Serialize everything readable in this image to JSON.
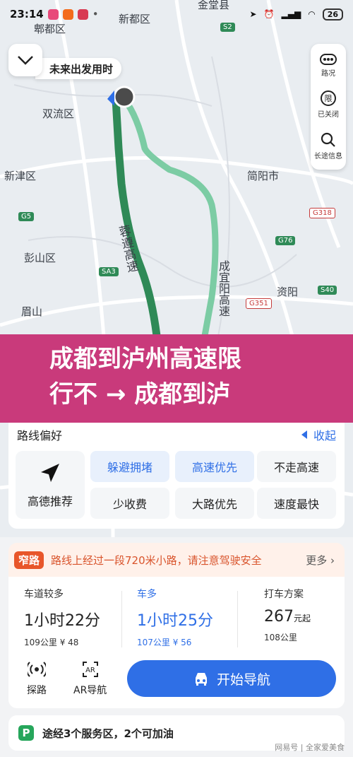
{
  "status_bar": {
    "time": "23:14",
    "battery": "26"
  },
  "map": {
    "labels": {
      "jinniu": "金堂县",
      "pixian": "郫都区",
      "xindu": "新都区",
      "shuangliu": "双流区",
      "xinjin": "新津区",
      "jianyang": "简阳市",
      "pengshan": "彭山区",
      "meishan": "眉山",
      "ziyang": "资阳",
      "route_a": "蓉遵高速",
      "route_b": "成宜阳高速"
    },
    "road_tags": {
      "s2": "S2",
      "g5": "G5",
      "sa3": "SA3",
      "g76": "G76",
      "g318": "G318",
      "g351": "G351",
      "s40": "S40"
    },
    "depart_label": "未来出发用时"
  },
  "toolbar": {
    "traffic": "路况",
    "restrict": "已关闭",
    "long_info": "长途信息"
  },
  "banner": {
    "line1": "成都到泸州高速限",
    "line2": "行不 → 成都到泸"
  },
  "preference": {
    "title": "路线偏好",
    "collapse": "收起",
    "recommend": "高德推荐",
    "options": [
      "躲避拥堵",
      "高速优先",
      "不走高速",
      "少收费",
      "大路优先",
      "速度最快"
    ]
  },
  "warning": {
    "badge": "窄路",
    "text": "路线上经过一段720米小路，请注意驾驶安全",
    "more": "更多"
  },
  "routes": [
    {
      "label": "车道较多",
      "time": "1小时22分",
      "meta": "109公里  ¥ 48"
    },
    {
      "label": "车多",
      "time": "1小时25分",
      "meta": "107公里  ¥ 56"
    },
    {
      "label": "打车方案",
      "price": "267",
      "unit": "元起",
      "meta": "108公里"
    }
  ],
  "actions": {
    "explore": "探路",
    "ar": "AR导航",
    "start": "开始导航"
  },
  "service": {
    "text": "途经3个服务区，2个可加油"
  },
  "watermark": "网易号 | 全家爱美食",
  "colors": {
    "accent": "#2f6fe6",
    "banner": "#c93a7b",
    "warning": "#e8562a",
    "route_main": "#2f8a57",
    "route_alt": "#7ccca4"
  }
}
